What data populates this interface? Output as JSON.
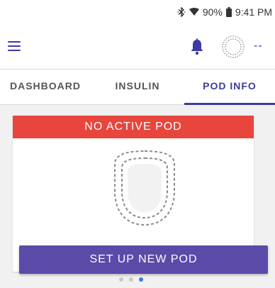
{
  "status_bar": {
    "battery": "90%",
    "time": "9:41 PM",
    "icons": [
      "bluetooth-icon",
      "wifi-icon",
      "battery-icon"
    ]
  },
  "app_bar": {
    "pod_status_text": "--",
    "icons": [
      "menu-icon",
      "bell-icon",
      "pod-status-icon"
    ]
  },
  "tabs": [
    {
      "label": "DASHBOARD",
      "active": false
    },
    {
      "label": "INSULIN",
      "active": false
    },
    {
      "label": "POD INFO",
      "active": true
    }
  ],
  "pod_card": {
    "banner": "NO ACTIVE POD",
    "setup_button": "SET UP NEW POD"
  },
  "pager": {
    "count": 3,
    "active_index": 2
  },
  "colors": {
    "accent": "#3d3aa3",
    "banner_red": "#e8453c",
    "button_purple": "#5b4aa8",
    "pager_active": "#3d7bd8"
  }
}
